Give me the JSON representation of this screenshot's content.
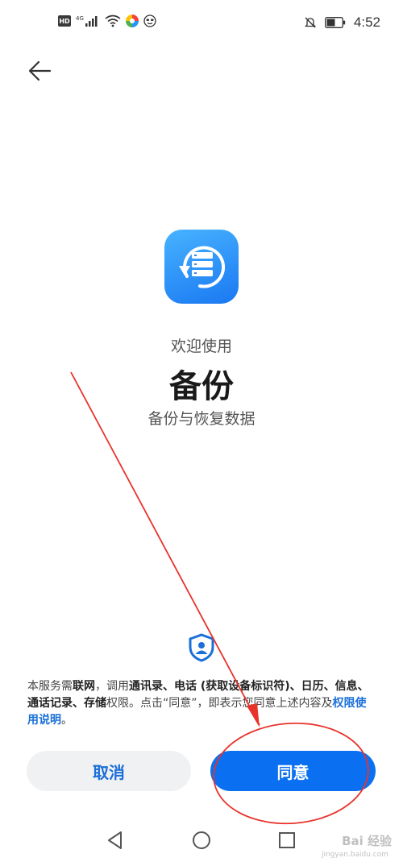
{
  "status_bar": {
    "hd": "HD",
    "network": "4G",
    "time": "4:52"
  },
  "welcome": "欢迎使用",
  "app_title": "备份",
  "subtitle": "备份与恢复数据",
  "notice": {
    "p1": "本服务需",
    "b1": "联网",
    "p2": "，调用",
    "b2": "通讯录、电话 (获取设备标识符)、日历、信息、通话记录、存储",
    "p3": "权限。点击“同意”，即表示您同意上述内容及",
    "link": "权限使用说明",
    "p4": "。"
  },
  "buttons": {
    "cancel": "取消",
    "agree": "同意"
  },
  "watermark": {
    "text": "Bai 经验",
    "sub": "jingyan.baidu.com"
  },
  "colors": {
    "accent": "#0a6ff0",
    "link": "#1a6fd8",
    "annotation": "#e8332a"
  },
  "icons": {
    "back": "back-arrow-icon",
    "app": "backup-icon",
    "privacy": "shield-user-icon",
    "nav_back": "triangle-back-icon",
    "nav_home": "circle-home-icon",
    "nav_recent": "square-recent-icon"
  }
}
